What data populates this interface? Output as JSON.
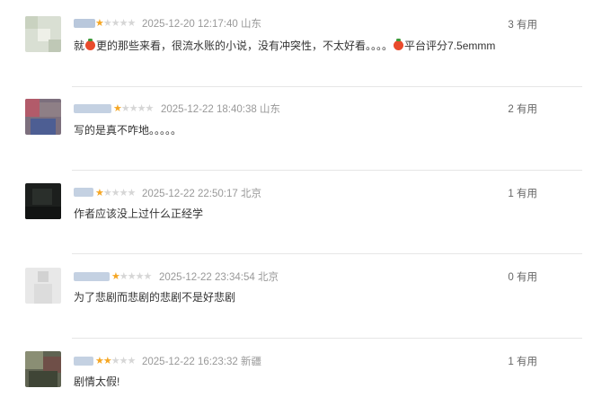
{
  "comments": [
    {
      "rating": 1,
      "datetime": "2025-12-20 12:17:40",
      "location": "山东",
      "helpful_label": "3 有用",
      "content_parts": [
        "就",
        "更的那些来看，很流水账的小说，没有冲突性，不太好看。。。。",
        "平台评分7.5emmm"
      ],
      "icons": [
        "tomato-icon"
      ]
    },
    {
      "rating": 1,
      "datetime": "2025-12-22 18:40:38",
      "location": "山东",
      "helpful_label": "2 有用",
      "content": "写的是真不咋地。。。。。"
    },
    {
      "rating": 1,
      "datetime": "2025-12-22 22:50:17",
      "location": "北京",
      "helpful_label": "1 有用",
      "content": "作者应该没上过什么正经学"
    },
    {
      "rating": 1,
      "datetime": "2025-12-22 23:34:54",
      "location": "北京",
      "helpful_label": "0 有用",
      "content": "为了悲剧而悲剧的悲剧不是好悲剧"
    },
    {
      "rating": 2,
      "datetime": "2025-12-22 16:23:32",
      "location": "新疆",
      "helpful_label": "1 有用",
      "content": "剧情太假!"
    }
  ],
  "colors": {
    "star_on": "#f5a623",
    "star_off": "#d6d6d6",
    "meta": "#999999"
  }
}
